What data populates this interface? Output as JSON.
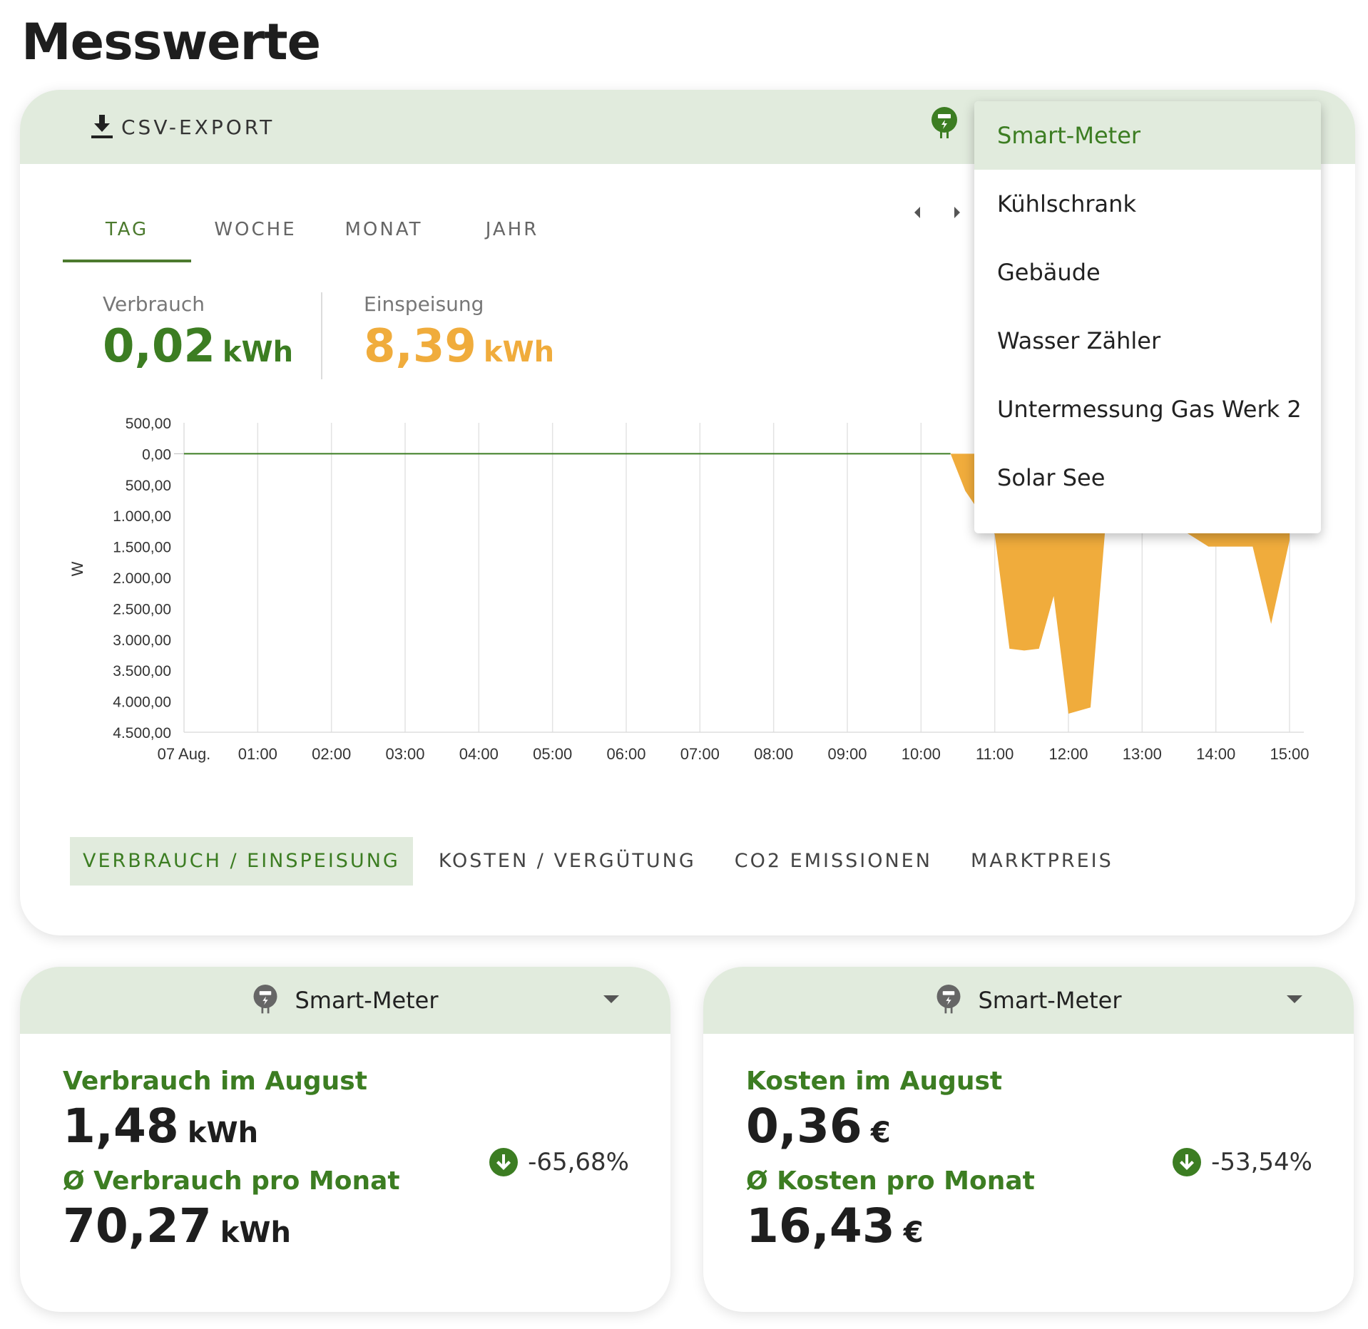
{
  "page": {
    "title": "Messwerte"
  },
  "toolbar": {
    "csv_export_label": "CSV-EXPORT",
    "meter_icon": "meter-icon"
  },
  "period_tabs": [
    {
      "label": "TAG",
      "active": true
    },
    {
      "label": "WOCHE",
      "active": false
    },
    {
      "label": "MONAT",
      "active": false
    },
    {
      "label": "JAHR",
      "active": false
    }
  ],
  "stats": {
    "consumption": {
      "label": "Verbrauch",
      "value": "0,02",
      "unit": "kWh"
    },
    "feed_in": {
      "label": "Einspeisung",
      "value": "8,39",
      "unit": "kWh"
    }
  },
  "colors": {
    "accent": "#3c7d22",
    "feed_in": "#f0ac3c",
    "header_bg": "#e1ebdd"
  },
  "chart_data": {
    "type": "area",
    "ylabel": "W",
    "y_tick_labels": [
      "500,00",
      "0,00",
      "500,00",
      "1.000,00",
      "1.500,00",
      "2.000,00",
      "2.500,00",
      "3.000,00",
      "3.500,00",
      "4.000,00",
      "4.500,00"
    ],
    "ylim": [
      -4500,
      500
    ],
    "x_tick_labels": [
      "07 Aug.",
      "01:00",
      "02:00",
      "03:00",
      "04:00",
      "05:00",
      "06:00",
      "07:00",
      "08:00",
      "09:00",
      "10:00",
      "11:00",
      "12:00",
      "13:00",
      "14:00",
      "15:00"
    ],
    "x_hours": [
      0,
      1,
      2,
      3,
      4,
      5,
      6,
      7,
      8,
      9,
      10,
      11,
      12,
      13,
      14,
      15
    ],
    "series": [
      {
        "name": "Verbrauch",
        "color": "#3c7d22",
        "x": [
          0,
          5,
          10,
          10.4
        ],
        "y": [
          0,
          0,
          0,
          0
        ]
      },
      {
        "name": "Einspeisung",
        "color": "#f0ac3c",
        "x": [
          10.4,
          10.6,
          11.0,
          11.2,
          11.4,
          11.6,
          11.8,
          12.0,
          12.3,
          12.5,
          13.0,
          13.5,
          13.9,
          14.2,
          14.5,
          14.75,
          15.0
        ],
        "y": [
          0,
          -600,
          -1300,
          -3150,
          -3180,
          -3150,
          -2300,
          -4200,
          -4100,
          -1200,
          -900,
          -1200,
          -1500,
          -1500,
          -1500,
          -2750,
          -1400
        ]
      }
    ],
    "grid": true
  },
  "metric_tabs": [
    {
      "label": "VERBRAUCH / EINSPEISUNG",
      "active": true
    },
    {
      "label": "KOSTEN / VERGÜTUNG",
      "active": false
    },
    {
      "label": "CO2 EMISSIONEN",
      "active": false
    },
    {
      "label": "MARKTPREIS",
      "active": false
    }
  ],
  "meter_dropdown": {
    "items": [
      "Smart-Meter",
      "Kühlschrank",
      "Gebäude",
      "Wasser Zähler",
      "Untermessung Gas Werk 2",
      "Solar See"
    ],
    "selected": "Smart-Meter"
  },
  "cards": [
    {
      "meter": "Smart-Meter",
      "label1": "Verbrauch im August",
      "value1": "1,48",
      "unit1": "kWh",
      "label2": "Ø Verbrauch pro Monat",
      "value2": "70,27",
      "unit2": "kWh",
      "change": "-65,68%"
    },
    {
      "meter": "Smart-Meter",
      "label1": "Kosten im August",
      "value1": "0,36",
      "unit1": "€",
      "label2": "Ø Kosten pro Monat",
      "value2": "16,43",
      "unit2": "€",
      "change": "-53,54%"
    }
  ]
}
